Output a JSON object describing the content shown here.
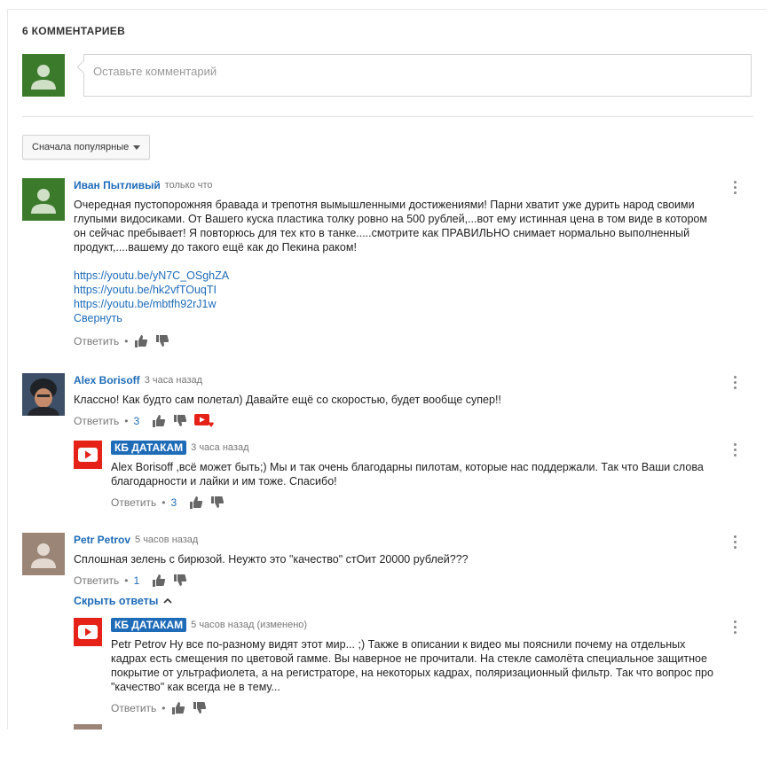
{
  "comments_header": {
    "count_label": "6 КОММЕНТАРИЕВ"
  },
  "composer": {
    "placeholder": "Оставьте комментарий"
  },
  "sort": {
    "label": "Сначала популярные"
  },
  "comments": [
    {
      "author": "Иван Пытливый",
      "time": "только что",
      "text": "Очередная пустопорожняя бравада и трепотня вымышленными достижениями! Парни хватит уже дурить народ своими глупыми видосиками. От Вашего куска пластика толку ровно на 500 рублей,...вот ему истинная цена в том виде в котором он сейчас пребывает! Я повторюсь для тех кто в танке.....смотрите как ПРАВИЛЬНО снимает нормально выполненный продукт,....вашему до такого ещё как до Пекина раком!",
      "links": [
        "https://youtu.be/yN7C_OSghZA",
        "https://youtu.be/hk2vfTOuqTI",
        "https://youtu.be/mbtfh92rJ1w"
      ],
      "collapse": "Свернуть",
      "reply": "Ответить"
    },
    {
      "author": "Alex Borisoff",
      "time": "3 часа назад",
      "text": "Классно! Как будто сам полетал) Давайте ещё со скоростью, будет вообще супер!!",
      "reply": "Ответить",
      "likes": "3"
    },
    {
      "author": "КБ ДАТАКАМ",
      "time": "3 часа назад",
      "text": "Alex Borisoff ,всё может быть;) Мы и так очень благодарны пилотам, которые нас поддержали. Так что Ваши слова благодарности и лайки и им тоже. Спасибо!",
      "reply": "Ответить",
      "likes": "3"
    },
    {
      "author": "Petr Petrov",
      "time": "5 часов назад",
      "text": "Сплошная зелень с бирюзой. Неужто это \"качество\" стОит 20000 рублей???",
      "reply": "Ответить",
      "likes": "1",
      "hide_replies": "Скрыть ответы"
    },
    {
      "author": "КБ ДАТАКАМ",
      "time": "5 часов назад (изменено)",
      "text": "Petr Petrov Ну все по-разному видят этот мир... ;) Также в описании к видео мы пояснили почему на отдельных кадрах есть смещения по цветовой гамме. Вы наверное не прочитали. На стекле самолёта специальное защитное покрытие от ультрафиолета, а на регистраторе, на некоторых кадрах, поляризационный фильтр. Так что вопрос про \"качество\" как всегда не в тему...",
      "reply": "Ответить"
    }
  ],
  "colors": {
    "link": "#1e6bb8",
    "avatar_green": "#3c7a2b",
    "channel_red": "#e62117"
  }
}
